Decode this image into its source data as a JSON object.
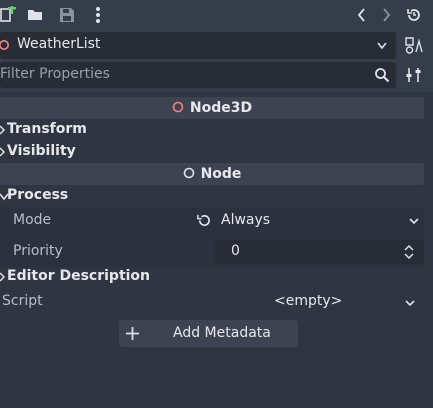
{
  "toolbar": {
    "icons": [
      "new-resource-icon",
      "open-folder-icon",
      "save-icon",
      "more-options-icon",
      "history-back-icon",
      "history-forward-icon",
      "history-icon"
    ]
  },
  "object": {
    "name": "WeatherList"
  },
  "filter": {
    "placeholder": "Filter Properties"
  },
  "sections": {
    "node3d": {
      "title": "Node3D",
      "transform": "Transform",
      "visibility": "Visibility"
    },
    "node": {
      "title": "Node",
      "process": "Process",
      "mode_label": "Mode",
      "mode_value": "Always",
      "priority_label": "Priority",
      "priority_value": "0",
      "editor_description": "Editor Description"
    }
  },
  "script": {
    "label": "Script",
    "value": "<empty>"
  },
  "add_metadata": {
    "label": "Add Metadata"
  },
  "colors": {
    "accent_node3d": "#fc7f7f",
    "background": "#363d4a",
    "panel": "#2f3541",
    "field": "#272c35"
  }
}
